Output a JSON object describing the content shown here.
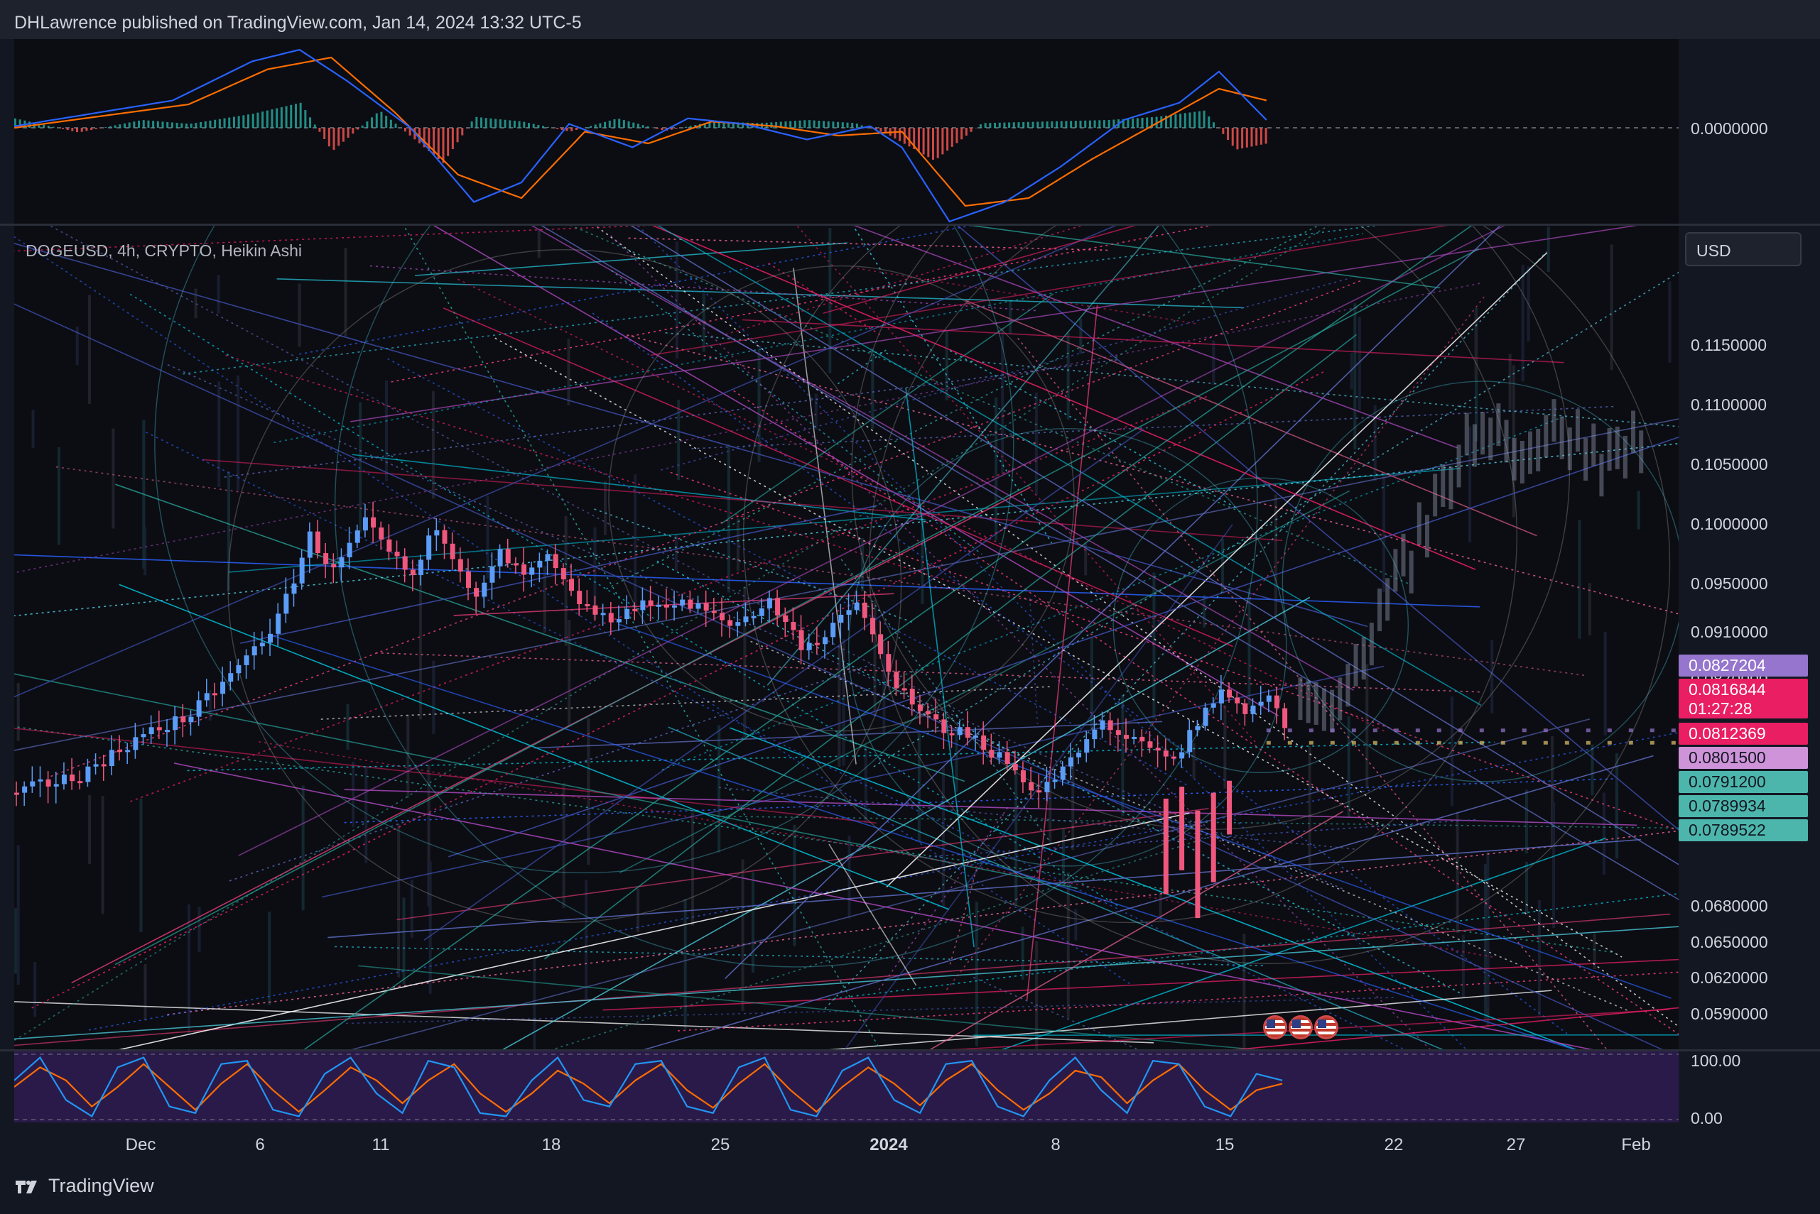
{
  "header": {
    "published": "DHLawrence published on TradingView.com, Jan 14, 2024 13:32 UTC-5"
  },
  "symbol_label": "DOGEUSD, 4h, CRYPTO, Heikin Ashi",
  "currency_button": "USD",
  "macd_axis": {
    "zero_label": "0.0000000"
  },
  "stoch_axis": {
    "top_label": "100.00",
    "bottom_label": "0.00"
  },
  "price_axis_labels": [
    "0.1150000",
    "0.1100000",
    "0.1050000",
    "0.1000000",
    "0.0950000",
    "0.0910000",
    "0.0870000",
    "0.0680000",
    "0.0650000",
    "0.0620000",
    "0.0590000"
  ],
  "price_badges": [
    {
      "value": "0.0827204",
      "color": "#9575cd",
      "text_color": "#ffffff"
    },
    {
      "value": "0.0816844",
      "color": "#e91e63",
      "text_color": "#ffffff"
    },
    {
      "value": "01:27:28",
      "color": "#e91e63",
      "text_color": "#ffffff"
    },
    {
      "value": "0.0812369",
      "color": "#e91e63",
      "text_color": "#ffffff"
    },
    {
      "value": "0.0801500",
      "color": "#ce93d8",
      "text_color": "#131722"
    },
    {
      "value": "0.0791200",
      "color": "#4db6ac",
      "text_color": "#131722"
    },
    {
      "value": "0.0789934",
      "color": "#4db6ac",
      "text_color": "#131722"
    },
    {
      "value": "0.0789522",
      "color": "#4db6ac",
      "text_color": "#131722"
    }
  ],
  "time_axis": [
    {
      "label": "Dec",
      "bold": false
    },
    {
      "label": "6",
      "bold": false
    },
    {
      "label": "11",
      "bold": false
    },
    {
      "label": "18",
      "bold": false
    },
    {
      "label": "25",
      "bold": false
    },
    {
      "label": "2024",
      "bold": true
    },
    {
      "label": "8",
      "bold": false
    },
    {
      "label": "15",
      "bold": false
    },
    {
      "label": "22",
      "bold": false
    },
    {
      "label": "27",
      "bold": false
    },
    {
      "label": "Feb",
      "bold": false
    }
  ],
  "brand": {
    "name": "TradingView"
  },
  "colors": {
    "background": "#0c0d13",
    "up": "#5b9cf6",
    "down": "#f0577d",
    "macd": "#2962ff",
    "signal": "#ff6d00",
    "hist_up": "#26a69a",
    "hist_down": "#ef5350",
    "stoch_k": "#2196f3",
    "stoch_d": "#ff6d00"
  },
  "chart_data": [
    {
      "type": "candlestick",
      "chart_style": "Heikin Ashi",
      "ylim": [
        0.056,
        0.125
      ],
      "price_path": [
        [
          0,
          0.0775
        ],
        [
          8,
          0.079
        ],
        [
          15,
          0.082
        ],
        [
          22,
          0.084
        ],
        [
          28,
          0.088
        ],
        [
          33,
          0.092
        ],
        [
          37,
          0.099
        ],
        [
          40,
          0.096
        ],
        [
          44,
          0.1
        ],
        [
          47,
          0.0975
        ],
        [
          50,
          0.0955
        ],
        [
          53,
          0.1
        ],
        [
          56,
          0.0965
        ],
        [
          58,
          0.0935
        ],
        [
          61,
          0.0975
        ],
        [
          64,
          0.0955
        ],
        [
          67,
          0.097
        ],
        [
          70,
          0.094
        ],
        [
          74,
          0.092
        ],
        [
          78,
          0.093
        ],
        [
          82,
          0.0935
        ],
        [
          86,
          0.093
        ],
        [
          90,
          0.0915
        ],
        [
          95,
          0.0935
        ],
        [
          99,
          0.09
        ],
        [
          102,
          0.0905
        ],
        [
          106,
          0.0935
        ],
        [
          109,
          0.089
        ],
        [
          113,
          0.0845
        ],
        [
          117,
          0.083
        ],
        [
          121,
          0.082
        ],
        [
          125,
          0.08
        ],
        [
          129,
          0.0775
        ],
        [
          133,
          0.08
        ],
        [
          137,
          0.0835
        ],
        [
          140,
          0.082
        ],
        [
          143,
          0.081
        ],
        [
          146,
          0.08
        ],
        [
          149,
          0.0835
        ],
        [
          152,
          0.086
        ],
        [
          155,
          0.0845
        ],
        [
          158,
          0.0855
        ],
        [
          160,
          0.083
        ]
      ],
      "future_projection": [
        [
          165,
          0.084
        ],
        [
          170,
          0.09
        ],
        [
          175,
          0.096
        ],
        [
          180,
          0.103
        ],
        [
          185,
          0.109
        ],
        [
          190,
          0.106
        ],
        [
          195,
          0.108
        ],
        [
          200,
          0.105
        ],
        [
          205,
          0.1075
        ]
      ]
    },
    {
      "type": "histogram",
      "panel": "MACD",
      "zero_label": "0.0000000",
      "macd_path": [
        [
          0,
          0.02
        ],
        [
          20,
          0.35
        ],
        [
          30,
          0.85
        ],
        [
          36,
          1.0
        ],
        [
          42,
          0.6
        ],
        [
          50,
          0.0
        ],
        [
          58,
          -0.95
        ],
        [
          64,
          -0.7
        ],
        [
          70,
          0.05
        ],
        [
          78,
          -0.25
        ],
        [
          85,
          0.12
        ],
        [
          92,
          0.05
        ],
        [
          100,
          -0.15
        ],
        [
          108,
          0.02
        ],
        [
          112,
          -0.25
        ],
        [
          118,
          -1.2
        ],
        [
          125,
          -0.95
        ],
        [
          132,
          -0.5
        ],
        [
          140,
          0.1
        ],
        [
          147,
          0.32
        ],
        [
          152,
          0.72
        ],
        [
          158,
          0.1
        ]
      ],
      "signal_path": [
        [
          0,
          0.0
        ],
        [
          22,
          0.3
        ],
        [
          32,
          0.75
        ],
        [
          40,
          0.9
        ],
        [
          48,
          0.2
        ],
        [
          56,
          -0.6
        ],
        [
          64,
          -0.9
        ],
        [
          72,
          -0.05
        ],
        [
          80,
          -0.2
        ],
        [
          88,
          0.08
        ],
        [
          96,
          0.02
        ],
        [
          104,
          -0.1
        ],
        [
          112,
          -0.05
        ],
        [
          120,
          -1.0
        ],
        [
          128,
          -0.9
        ],
        [
          136,
          -0.4
        ],
        [
          144,
          0.05
        ],
        [
          152,
          0.5
        ],
        [
          158,
          0.35
        ]
      ],
      "hist_path": [
        [
          0,
          0.12
        ],
        [
          8,
          -0.06
        ],
        [
          16,
          0.1
        ],
        [
          22,
          0.05
        ],
        [
          30,
          0.18
        ],
        [
          36,
          0.32
        ],
        [
          40,
          -0.3
        ],
        [
          46,
          0.22
        ],
        [
          54,
          -0.45
        ],
        [
          58,
          0.14
        ],
        [
          64,
          0.08
        ],
        [
          70,
          -0.05
        ],
        [
          76,
          0.12
        ],
        [
          82,
          -0.04
        ],
        [
          88,
          0.08
        ],
        [
          94,
          0.06
        ],
        [
          100,
          0.1
        ],
        [
          106,
          0.06
        ],
        [
          110,
          -0.08
        ],
        [
          116,
          -0.42
        ],
        [
          122,
          0.06
        ],
        [
          130,
          0.08
        ],
        [
          138,
          0.1
        ],
        [
          144,
          0.14
        ],
        [
          150,
          0.22
        ],
        [
          154,
          -0.28
        ],
        [
          158,
          -0.2
        ]
      ]
    },
    {
      "type": "line",
      "panel": "Stochastic",
      "ylim": [
        0,
        100
      ],
      "series": [
        {
          "values": [
            60,
            95,
            30,
            5,
            80,
            95,
            20,
            10,
            85,
            90,
            15,
            5,
            70,
            95,
            40,
            10,
            90,
            80,
            10,
            5,
            60,
            95,
            30,
            20,
            85,
            90,
            20,
            10,
            80,
            95,
            15,
            5,
            75,
            95,
            30,
            10,
            85,
            90,
            20,
            5,
            60,
            95,
            45,
            10,
            90,
            85,
            20,
            5,
            70,
            60
          ]
        },
        {
          "values": [
            50,
            80,
            60,
            20,
            50,
            85,
            50,
            15,
            55,
            85,
            45,
            12,
            45,
            80,
            60,
            25,
            60,
            85,
            40,
            12,
            40,
            75,
            55,
            25,
            60,
            85,
            45,
            18,
            55,
            85,
            45,
            12,
            50,
            80,
            55,
            22,
            60,
            85,
            45,
            15,
            40,
            75,
            65,
            25,
            60,
            85,
            45,
            15,
            45,
            55
          ]
        }
      ]
    }
  ]
}
